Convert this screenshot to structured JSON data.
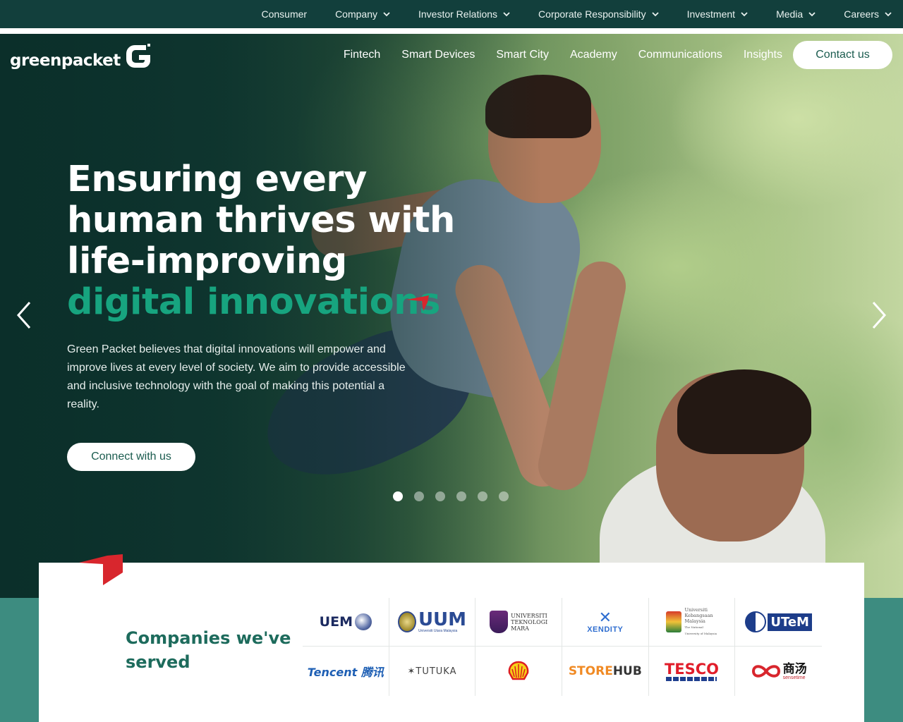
{
  "topbar": {
    "items": [
      {
        "label": "Consumer",
        "dropdown": false
      },
      {
        "label": "Company",
        "dropdown": true
      },
      {
        "label": "Investor Relations",
        "dropdown": true
      },
      {
        "label": "Corporate Responsibility",
        "dropdown": true
      },
      {
        "label": "Investment",
        "dropdown": true
      },
      {
        "label": "Media",
        "dropdown": true
      },
      {
        "label": "Careers",
        "dropdown": true
      }
    ]
  },
  "header": {
    "logo_text": "greenpacket",
    "nav": [
      "Fintech",
      "Smart Devices",
      "Smart City",
      "Academy",
      "Communications",
      "Insights"
    ],
    "contact_label": "Contact us"
  },
  "hero": {
    "headline_lines": [
      "Ensuring every",
      "human thrives with",
      "life-improving"
    ],
    "headline_accent": "digital innovations",
    "description": "Green Packet believes that digital innovations will empower and improve lives at every level of society. We aim to provide accessible and inclusive technology with the goal of making this potential a reality.",
    "cta_label": "Connect with us",
    "slide_count": 6,
    "active_slide": 1
  },
  "partners": {
    "title": "Companies we've served",
    "logos": [
      {
        "name": "UEM",
        "text": "UEM"
      },
      {
        "name": "UUM",
        "text": "UUM",
        "subtext": "Universiti Utara Malaysia"
      },
      {
        "name": "UiTM",
        "text": "UNIVERSITI TEKNOLOGI MARA"
      },
      {
        "name": "Xendity",
        "text": "XENDITY"
      },
      {
        "name": "UKM",
        "text": "Universiti Kebangsaan Malaysia",
        "subtext": "The National University of Malaysia"
      },
      {
        "name": "UTeM",
        "text": "UTeM"
      },
      {
        "name": "Tencent",
        "text": "Tencent 腾讯"
      },
      {
        "name": "Tutuka",
        "text": "TUTUKA"
      },
      {
        "name": "Shell",
        "text": ""
      },
      {
        "name": "StoreHub",
        "text_a": "STORE",
        "text_b": "HUB"
      },
      {
        "name": "Tesco",
        "text": "TESCO"
      },
      {
        "name": "SenseTime",
        "text": "商汤",
        "subtext": "sensetime"
      }
    ]
  },
  "colors": {
    "topbar_bg": "#123f3c",
    "accent_green": "#17a47f",
    "heading_green": "#1d6b5c",
    "teal_band": "#3d8c80",
    "brand_red": "#d8262d"
  },
  "icons": {
    "prev": "chevron-left-icon",
    "next": "chevron-right-icon",
    "dropdown": "chevron-down-icon"
  }
}
